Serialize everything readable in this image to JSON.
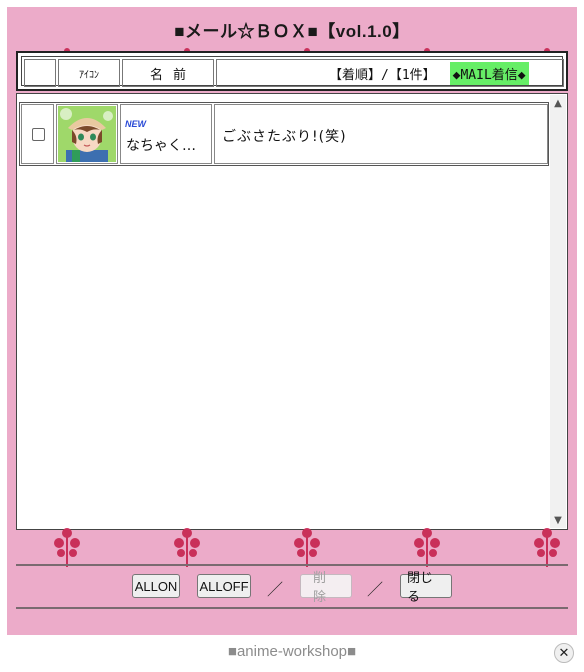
{
  "window": {
    "title": "■メール☆ＢＯＸ■【vol.1.0】"
  },
  "header": {
    "icon_label": "ｱｲｺﾝ",
    "name_label": "名前",
    "sort_info": "【着順】/【1件】",
    "mail_badge": "◆MAIL着信◆"
  },
  "messages": [
    {
      "checked": false,
      "badge": "NEW",
      "sender": "なちゃく…",
      "subject": "ごぶさたぶり!(笑)",
      "avatar_icon": "avatar-icon"
    }
  ],
  "buttons": {
    "all_on": "ALLON",
    "all_off": "ALLOFF",
    "delete": "削除",
    "close": "閉じる",
    "separator": "／"
  },
  "footer": {
    "credit": "■anime-workshop■",
    "close_glyph": "✕"
  },
  "colors": {
    "background": "#ecabc9",
    "badge_green": "#66ee66",
    "tree_red": "#c9305a"
  }
}
